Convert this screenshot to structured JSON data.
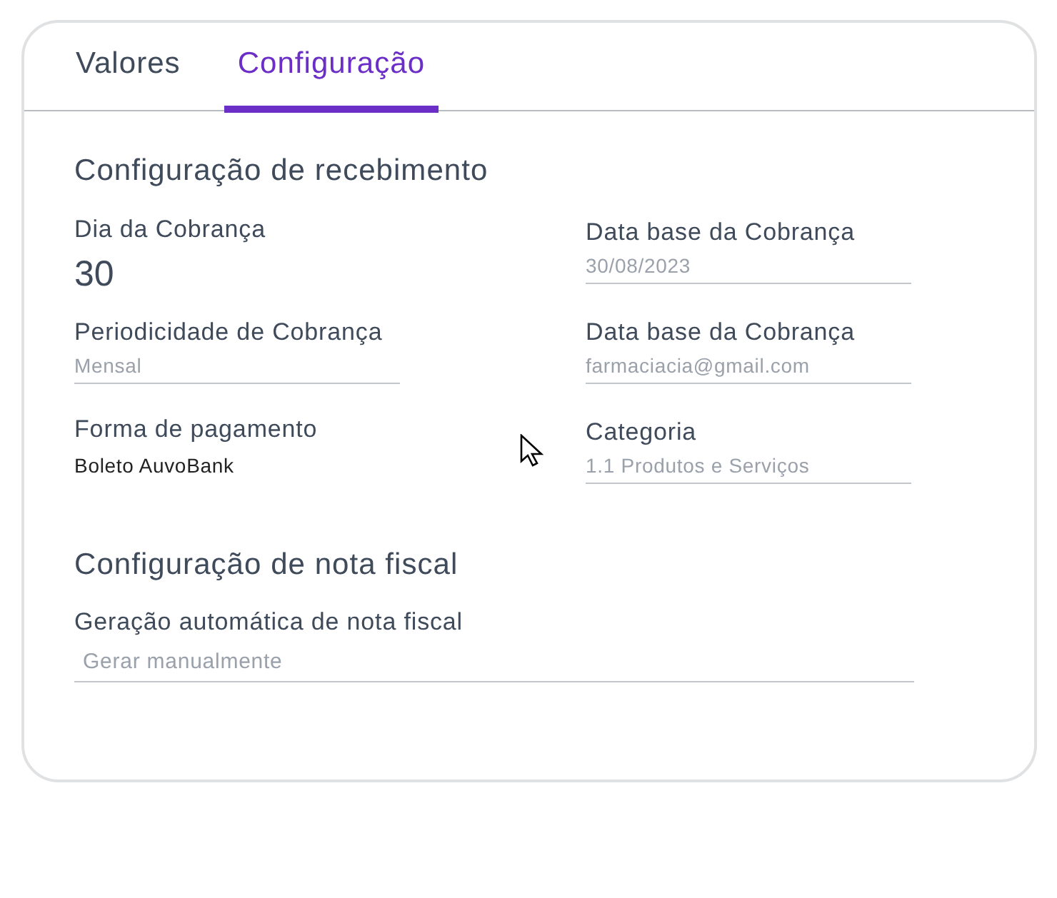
{
  "tabs": [
    {
      "label": "Valores",
      "selected": false
    },
    {
      "label": "Configuração",
      "selected": true
    }
  ],
  "sections": [
    {
      "title": "Configuração de recebimento",
      "fields": [
        {
          "kind": "big",
          "label": "Dia da Cobrança",
          "value": "30"
        },
        {
          "kind": "line",
          "label": "Data base da Cobrança",
          "value": "30/08/2023"
        },
        {
          "kind": "line",
          "label": "Periodicidade de Cobrança",
          "value": "Mensal"
        },
        {
          "kind": "line",
          "label": "Data base da Cobrança",
          "value": "farmaciacia@gmail.com"
        },
        {
          "kind": "plain",
          "label": "Forma de pagamento",
          "value": "Boleto AuvoBank"
        },
        {
          "kind": "line",
          "label": "Categoria",
          "value": "1.1 Produtos e Serviços"
        }
      ]
    },
    {
      "title": "Configuração de nota fiscal",
      "fields": [
        {
          "kind": "wide",
          "label": "Geração automática de nota fiscal",
          "value": "Gerar manualmente"
        }
      ]
    }
  ]
}
